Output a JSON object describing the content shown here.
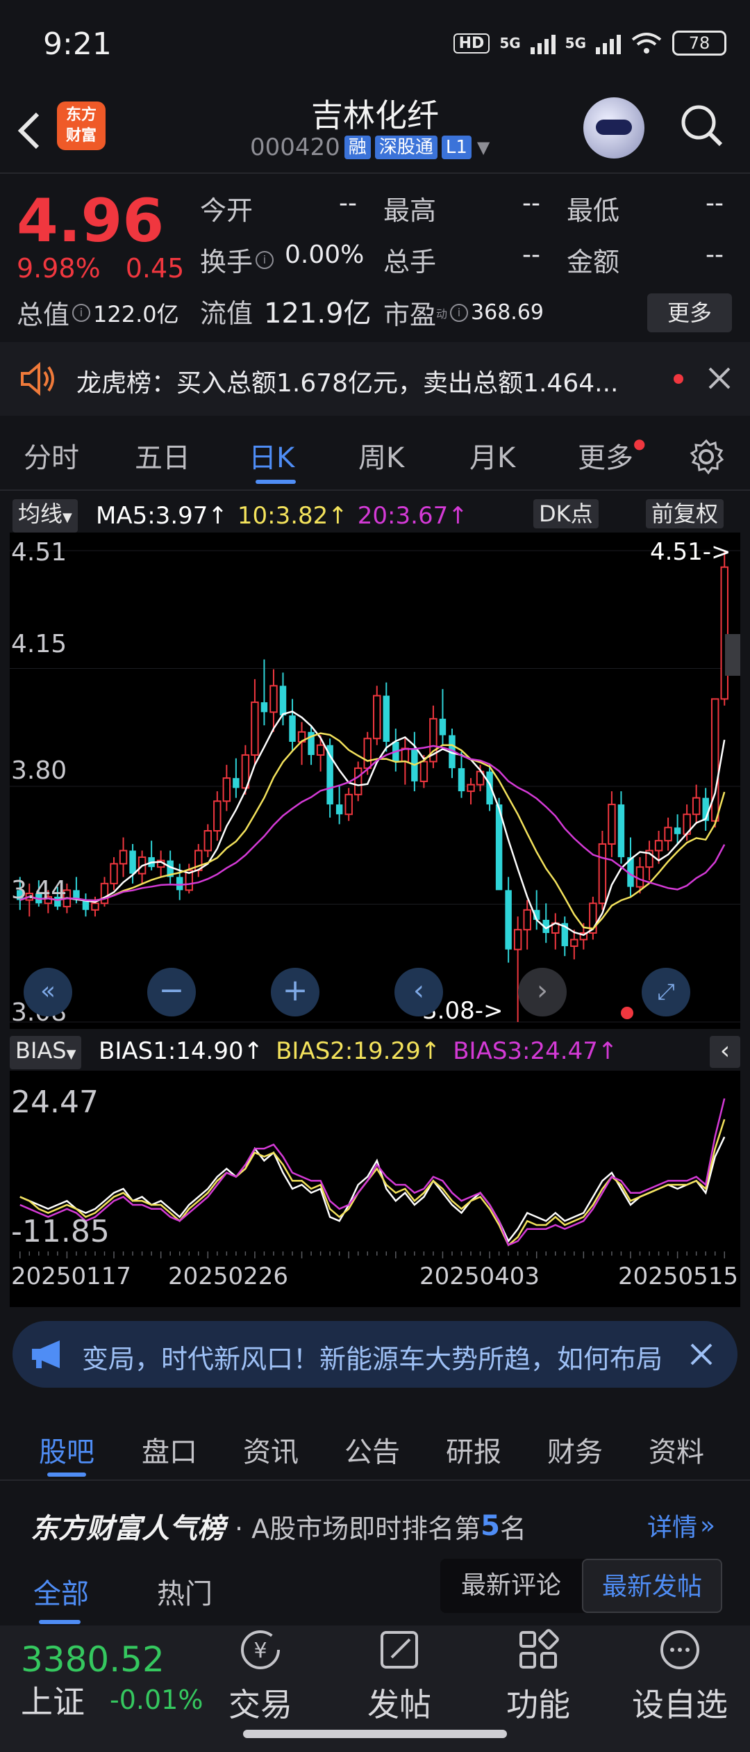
{
  "status": {
    "time": "9:21",
    "hd": "HD",
    "net1": "5G",
    "net2": "5G",
    "battery": "78"
  },
  "header": {
    "name": "吉林化纤",
    "code": "000420",
    "chips": [
      "融",
      "深股通",
      "L1"
    ],
    "logo": [
      "东方",
      "财富"
    ]
  },
  "quote": {
    "price": "4.96",
    "pct": "9.98%",
    "change": "0.45",
    "rows": [
      [
        {
          "l": "今开",
          "v": "--"
        },
        {
          "l": "最高",
          "v": "--"
        },
        {
          "l": "最低",
          "v": "--"
        }
      ],
      [
        {
          "l": "换手",
          "v": "0.00%"
        },
        {
          "l": "总手",
          "v": "--"
        },
        {
          "l": "金额",
          "v": "--"
        }
      ]
    ],
    "total_value_label": "总值",
    "total_value": "122.0亿",
    "float_label": "流值",
    "float_value": "121.9亿",
    "pe_label": "市盈",
    "pe_sup": "动",
    "pe_value": "368.69",
    "more": "更多"
  },
  "lhb": {
    "text": "龙虎榜：买入总额1.678亿元，卖出总额1.464..."
  },
  "period_tabs": [
    "分时",
    "五日",
    "日K",
    "周K",
    "月K",
    "更多"
  ],
  "chart_top": {
    "ma_select": "均线",
    "ma5": "MA5:3.97↑",
    "ma10": "10:3.82↑",
    "ma20": "20:3.67↑",
    "dk": "DK点",
    "fq": "前复权"
  },
  "kline": {
    "y_labels": [
      "4.51",
      "4.15",
      "3.80",
      "3.44",
      "3.08"
    ],
    "max_marker": "4.51->",
    "min_marker": "3.08->"
  },
  "bias_head": {
    "select": "BIAS",
    "b1": "BIAS1:14.90↑",
    "b2": "BIAS2:19.29↑",
    "b3": "BIAS3:24.47↑",
    "top": "24.47",
    "bottom": "-11.85"
  },
  "dates": [
    "20250117",
    "20250226",
    "20250403",
    "20250515"
  ],
  "chart_data": {
    "type": "candlestick",
    "ylim": [
      3.08,
      4.51
    ],
    "colors": {
      "up": "#f0373f",
      "down": "#2fd4d8",
      "ma5": "#ffffff",
      "ma10": "#f3e25c",
      "ma20": "#d43ad6"
    },
    "ohlc": [
      [
        3.48,
        3.52,
        3.42,
        3.45
      ],
      [
        3.45,
        3.5,
        3.4,
        3.47
      ],
      [
        3.47,
        3.51,
        3.43,
        3.44
      ],
      [
        3.44,
        3.48,
        3.41,
        3.46
      ],
      [
        3.46,
        3.49,
        3.42,
        3.43
      ],
      [
        3.43,
        3.5,
        3.41,
        3.48
      ],
      [
        3.48,
        3.52,
        3.44,
        3.45
      ],
      [
        3.45,
        3.47,
        3.4,
        3.42
      ],
      [
        3.42,
        3.46,
        3.4,
        3.44
      ],
      [
        3.44,
        3.52,
        3.43,
        3.5
      ],
      [
        3.5,
        3.58,
        3.48,
        3.56
      ],
      [
        3.56,
        3.64,
        3.52,
        3.6
      ],
      [
        3.6,
        3.62,
        3.5,
        3.53
      ],
      [
        3.53,
        3.6,
        3.5,
        3.58
      ],
      [
        3.58,
        3.63,
        3.54,
        3.55
      ],
      [
        3.55,
        3.6,
        3.52,
        3.57
      ],
      [
        3.57,
        3.6,
        3.5,
        3.52
      ],
      [
        3.52,
        3.56,
        3.45,
        3.48
      ],
      [
        3.48,
        3.56,
        3.47,
        3.54
      ],
      [
        3.54,
        3.62,
        3.52,
        3.6
      ],
      [
        3.6,
        3.68,
        3.58,
        3.66
      ],
      [
        3.66,
        3.78,
        3.63,
        3.75
      ],
      [
        3.75,
        3.86,
        3.72,
        3.82
      ],
      [
        3.82,
        3.88,
        3.76,
        3.79
      ],
      [
        3.79,
        3.92,
        3.77,
        3.89
      ],
      [
        3.89,
        4.12,
        3.86,
        4.05
      ],
      [
        4.05,
        4.18,
        3.98,
        4.02
      ],
      [
        4.02,
        4.15,
        3.96,
        4.1
      ],
      [
        4.1,
        4.14,
        3.98,
        4.01
      ],
      [
        4.01,
        4.06,
        3.9,
        3.93
      ],
      [
        3.93,
        3.99,
        3.86,
        3.96
      ],
      [
        3.96,
        3.98,
        3.86,
        3.89
      ],
      [
        3.89,
        3.95,
        3.84,
        3.92
      ],
      [
        3.92,
        3.94,
        3.7,
        3.74
      ],
      [
        3.74,
        3.8,
        3.68,
        3.71
      ],
      [
        3.71,
        3.79,
        3.69,
        3.77
      ],
      [
        3.77,
        3.87,
        3.75,
        3.85
      ],
      [
        3.85,
        3.96,
        3.83,
        3.94
      ],
      [
        3.94,
        4.1,
        3.92,
        4.07
      ],
      [
        4.07,
        4.11,
        3.9,
        3.93
      ],
      [
        3.93,
        3.97,
        3.84,
        3.87
      ],
      [
        3.87,
        3.94,
        3.8,
        3.91
      ],
      [
        3.91,
        3.96,
        3.78,
        3.81
      ],
      [
        3.81,
        3.89,
        3.79,
        3.87
      ],
      [
        3.87,
        4.04,
        3.85,
        4.0
      ],
      [
        4.0,
        4.09,
        3.92,
        3.95
      ],
      [
        3.95,
        3.97,
        3.82,
        3.85
      ],
      [
        3.85,
        3.9,
        3.76,
        3.78
      ],
      [
        3.78,
        3.82,
        3.74,
        3.8
      ],
      [
        3.8,
        3.86,
        3.78,
        3.84
      ],
      [
        3.84,
        3.86,
        3.72,
        3.74
      ],
      [
        3.74,
        3.76,
        3.52,
        3.48
      ],
      [
        3.48,
        3.52,
        3.26,
        3.3
      ],
      [
        3.3,
        3.4,
        3.08,
        3.36
      ],
      [
        3.36,
        3.45,
        3.3,
        3.42
      ],
      [
        3.42,
        3.48,
        3.36,
        3.39
      ],
      [
        3.39,
        3.44,
        3.32,
        3.35
      ],
      [
        3.35,
        3.41,
        3.3,
        3.38
      ],
      [
        3.38,
        3.4,
        3.28,
        3.31
      ],
      [
        3.31,
        3.36,
        3.27,
        3.33
      ],
      [
        3.33,
        3.38,
        3.3,
        3.35
      ],
      [
        3.35,
        3.46,
        3.33,
        3.44
      ],
      [
        3.44,
        3.66,
        3.42,
        3.62
      ],
      [
        3.62,
        3.78,
        3.58,
        3.74
      ],
      [
        3.74,
        3.78,
        3.56,
        3.58
      ],
      [
        3.58,
        3.64,
        3.46,
        3.49
      ],
      [
        3.49,
        3.58,
        3.47,
        3.55
      ],
      [
        3.55,
        3.63,
        3.51,
        3.6
      ],
      [
        3.6,
        3.66,
        3.56,
        3.63
      ],
      [
        3.63,
        3.7,
        3.6,
        3.67
      ],
      [
        3.67,
        3.71,
        3.62,
        3.65
      ],
      [
        3.65,
        3.74,
        3.63,
        3.71
      ],
      [
        3.71,
        3.8,
        3.68,
        3.76
      ],
      [
        3.76,
        3.79,
        3.66,
        3.69
      ],
      [
        3.69,
        4.06,
        3.67,
        4.06
      ],
      [
        4.06,
        4.51,
        4.04,
        4.46
      ]
    ],
    "bias": {
      "ylim": [
        -11.85,
        24.47
      ],
      "bias1": [
        0,
        -1,
        -2,
        -3,
        -2,
        -1,
        -3,
        -4,
        -3,
        -1,
        1,
        2,
        -1,
        0,
        -2,
        -1,
        -3,
        -5,
        -2,
        0,
        2,
        5,
        7,
        5,
        7,
        12,
        9,
        11,
        6,
        2,
        3,
        1,
        2,
        -5,
        -6,
        -2,
        3,
        5,
        9,
        2,
        -1,
        1,
        -2,
        0,
        4,
        1,
        -2,
        -4,
        -1,
        1,
        -2,
        -6,
        -11,
        -8,
        -4,
        -5,
        -6,
        -4,
        -6,
        -5,
        -4,
        0,
        4,
        6,
        2,
        -2,
        0,
        1,
        2,
        3,
        2,
        3,
        4,
        1,
        10,
        14.9
      ],
      "bias2": [
        0,
        -1,
        -3,
        -4,
        -3,
        -2,
        -3,
        -5,
        -4,
        -2,
        0,
        1,
        -1,
        -1,
        -2,
        -2,
        -4,
        -6,
        -3,
        -1,
        1,
        4,
        6,
        5,
        7,
        11,
        10,
        11,
        8,
        4,
        4,
        2,
        3,
        -3,
        -5,
        -3,
        1,
        4,
        7,
        3,
        1,
        2,
        -1,
        1,
        4,
        2,
        -1,
        -3,
        -1,
        0,
        -3,
        -7,
        -12,
        -10,
        -6,
        -7,
        -7,
        -5,
        -7,
        -6,
        -5,
        -2,
        2,
        5,
        3,
        -1,
        0,
        1,
        2,
        3,
        3,
        3,
        4,
        2,
        12,
        19.29
      ],
      "bias3": [
        -2,
        -3,
        -4,
        -5,
        -4,
        -3,
        -4,
        -6,
        -5,
        -3,
        -1,
        0,
        -2,
        -2,
        -3,
        -3,
        -5,
        -6,
        -4,
        -2,
        0,
        3,
        6,
        5,
        8,
        12,
        12,
        13,
        10,
        6,
        5,
        4,
        4,
        -1,
        -3,
        -2,
        1,
        4,
        8,
        5,
        3,
        3,
        1,
        2,
        5,
        4,
        1,
        -1,
        0,
        1,
        -2,
        -6,
        -12,
        -11,
        -8,
        -8,
        -8,
        -7,
        -8,
        -7,
        -6,
        -3,
        1,
        5,
        4,
        1,
        1,
        2,
        3,
        4,
        4,
        4,
        5,
        3,
        15,
        24.47
      ]
    }
  },
  "banner": {
    "text": "变局，时代新风口！新能源车大势所趋，如何布局"
  },
  "bottom_tabs": [
    "股吧",
    "盘口",
    "资讯",
    "公告",
    "研报",
    "财务",
    "资料"
  ],
  "rank": {
    "brand": "东方财富人气榜",
    "pre": "· A股市场即时排名第",
    "num": "5",
    "post": "名",
    "detail": "详情"
  },
  "subtabs": {
    "all": "全部",
    "hot": "热门",
    "latest_comment": "最新评论",
    "latest_post": "最新发帖"
  },
  "nav": {
    "index_value": "3380.52",
    "index_name": "上证",
    "index_change": "-0.01%",
    "items": [
      "交易",
      "发帖",
      "功能",
      "设自选"
    ]
  }
}
